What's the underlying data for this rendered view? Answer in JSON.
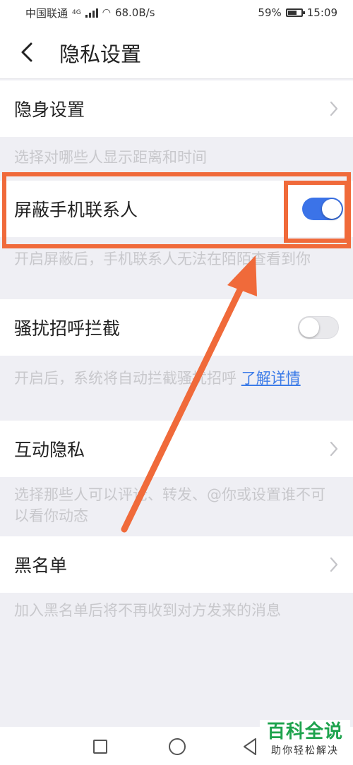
{
  "status_bar": {
    "carrier": "中国联通",
    "network": "4G",
    "speed": "68.0B/s",
    "battery": "59%",
    "time": "15:09"
  },
  "nav": {
    "title": "隐私设置",
    "back_icon": "chevron-left-icon"
  },
  "settings": {
    "stealth": {
      "label": "隐身设置",
      "hint": "选择对哪些人显示距离和时间"
    },
    "block_contacts": {
      "label": "屏蔽手机联系人",
      "enabled": true,
      "hint": "开启屏蔽后，手机联系人无法在陌陌查看到你"
    },
    "harass_block": {
      "label": "骚扰招呼拦截",
      "enabled": false,
      "hint": "开启后，系统将自动拦截骚扰招呼 ",
      "link": "了解详情"
    },
    "interaction_privacy": {
      "label": "互动隐私",
      "hint": "选择那些人可以评论、转发、@你或设置谁不可以看你动态"
    },
    "blacklist": {
      "label": "黑名单",
      "hint": "加入黑名单后将不再收到对方发来的消息"
    }
  },
  "annotation": {
    "color": "#f06a3a"
  },
  "colors": {
    "accent": "#3b73e8",
    "link": "#3b7be8",
    "hint": "#c8c8cc",
    "background": "#efeff4"
  },
  "watermark": {
    "title": "百科全说",
    "subtitle": "助你轻松解决"
  }
}
